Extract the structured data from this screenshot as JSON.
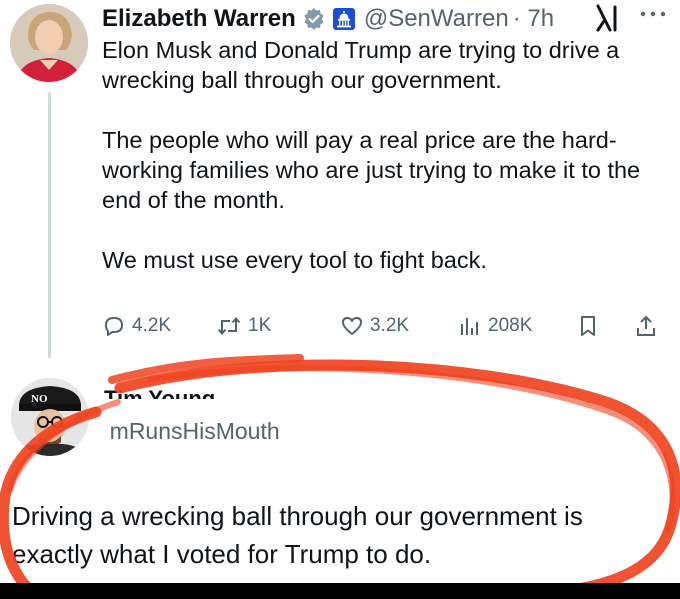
{
  "tweet": {
    "author_name": "Elizabeth Warren",
    "handle": "@SenWarren",
    "time": "· 7h",
    "paragraphs": [
      "Elon Musk and Donald Trump are trying to drive a wrecking ball through our government.",
      "The people who will pay a real price are the hard-working families who are just trying to make it to the end of the month.",
      "We must use every tool to fight back."
    ],
    "actions": {
      "replies": "4.2K",
      "reposts": "1K",
      "likes": "3.2K",
      "views": "208K"
    },
    "icons": [
      "verified-badge-icon",
      "capitol-badge-icon",
      "grok-icon",
      "more-icon",
      "reply-icon",
      "repost-icon",
      "like-icon",
      "views-icon",
      "bookmark-icon",
      "share-icon"
    ]
  },
  "reply": {
    "author_name_fragment": "Tim Young",
    "handle": "@TimRunsHisMouth",
    "text": "Driving a wrecking ball through our government is exactly what I voted for Trump to do.",
    "avatar_hat_text": "NO"
  },
  "colors": {
    "text": "#0f1419",
    "secondary": "#536471",
    "verified": "#829aab",
    "capitol_badge": "#1d4ed8",
    "annotation_circle": "#f0431f"
  }
}
